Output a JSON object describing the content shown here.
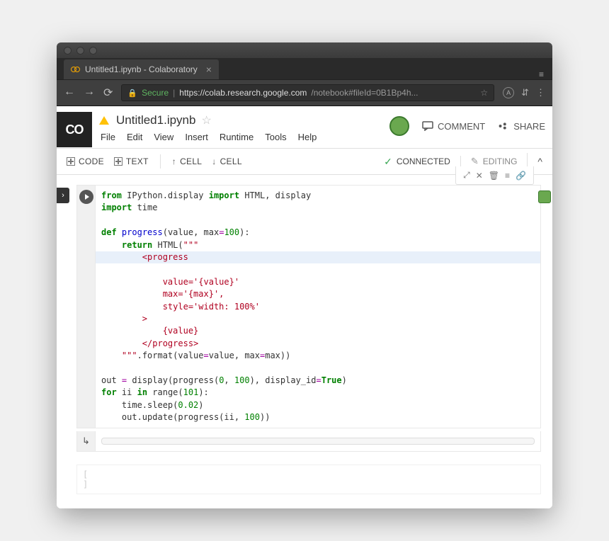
{
  "browser": {
    "tab_title": "Untitled1.ipynb - Colaboratory",
    "secure_label": "Secure",
    "url_host": "https://colab.research.google.com",
    "url_path": "/notebook#fileId=0B1Bp4h...",
    "menu_glyph": "≡"
  },
  "doc": {
    "title": "Untitled1.ipynb",
    "menus": [
      "File",
      "Edit",
      "View",
      "Insert",
      "Runtime",
      "Tools",
      "Help"
    ]
  },
  "header": {
    "comment": "COMMENT",
    "share": "SHARE"
  },
  "toolbar": {
    "code": "CODE",
    "text": "TEXT",
    "cell_up": "CELL",
    "cell_down": "CELL",
    "connected": "CONNECTED",
    "editing": "EDITING"
  },
  "cell_toolbar": {
    "expand": "⤢",
    "close": "✕",
    "delete": "🗑",
    "toc": "≡",
    "link": "🔗"
  },
  "code": {
    "lines": [
      {
        "t": [
          [
            "kw",
            "from"
          ],
          [
            "nm",
            " IPython.display "
          ],
          [
            "kw",
            "import"
          ],
          [
            "nm",
            " HTML, display"
          ]
        ]
      },
      {
        "t": [
          [
            "kw",
            "import"
          ],
          [
            "nm",
            " time"
          ]
        ]
      },
      {
        "t": []
      },
      {
        "t": [
          [
            "kw",
            "def"
          ],
          [
            "nm",
            " "
          ],
          [
            "fn",
            "progress"
          ],
          [
            "nm",
            "(value, max"
          ],
          [
            "op",
            "="
          ],
          [
            "nu",
            "100"
          ],
          [
            "nm",
            "):"
          ]
        ]
      },
      {
        "t": [
          [
            "nm",
            "    "
          ],
          [
            "kw",
            "return"
          ],
          [
            "nm",
            " HTML("
          ],
          [
            "st",
            "\"\"\""
          ]
        ]
      },
      {
        "hl": true,
        "t": [
          [
            "st",
            "        <progress"
          ]
        ]
      },
      {
        "t": [
          [
            "st",
            "            value='{value}'"
          ]
        ]
      },
      {
        "t": [
          [
            "st",
            "            max='{max}',"
          ]
        ]
      },
      {
        "t": [
          [
            "st",
            "            style='width: 100%'"
          ]
        ]
      },
      {
        "t": [
          [
            "st",
            "        >"
          ]
        ]
      },
      {
        "t": [
          [
            "st",
            "            {value}"
          ]
        ]
      },
      {
        "t": [
          [
            "st",
            "        </progress>"
          ]
        ]
      },
      {
        "t": [
          [
            "st",
            "    \"\"\""
          ],
          [
            "nm",
            "."
          ],
          [
            "nm",
            "format(value"
          ],
          [
            "op",
            "="
          ],
          [
            "nm",
            "value, max"
          ],
          [
            "op",
            "="
          ],
          [
            "nm",
            "max))"
          ]
        ]
      },
      {
        "t": []
      },
      {
        "t": [
          [
            "nm",
            "out "
          ],
          [
            "op",
            "="
          ],
          [
            "nm",
            " display(progress("
          ],
          [
            "nu",
            "0"
          ],
          [
            "nm",
            ", "
          ],
          [
            "nu",
            "100"
          ],
          [
            "nm",
            "), display_id"
          ],
          [
            "op",
            "="
          ],
          [
            "kw",
            "True"
          ],
          [
            "nm",
            ")"
          ]
        ]
      },
      {
        "t": [
          [
            "kw",
            "for"
          ],
          [
            "nm",
            " ii "
          ],
          [
            "kw",
            "in"
          ],
          [
            "nm",
            " range("
          ],
          [
            "nu",
            "101"
          ],
          [
            "nm",
            "):"
          ]
        ]
      },
      {
        "t": [
          [
            "nm",
            "    time.sleep("
          ],
          [
            "nu",
            "0.02"
          ],
          [
            "nm",
            ")"
          ]
        ]
      },
      {
        "t": [
          [
            "nm",
            "    out.update(progress(ii, "
          ],
          [
            "nu",
            "100"
          ],
          [
            "nm",
            "))"
          ]
        ]
      }
    ]
  },
  "output": {
    "icon": "↳",
    "progress_value": 0,
    "progress_max": 100
  },
  "empty_cell": {
    "prompt": "[ ]"
  }
}
